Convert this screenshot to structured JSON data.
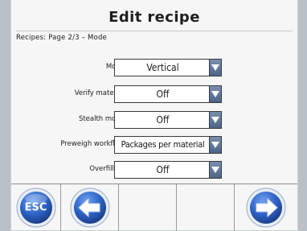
{
  "header": {
    "title": "Edit recipe",
    "breadcrumb": "Recipes: Page 2/3 – Mode"
  },
  "form": {
    "rows": [
      {
        "label": "Mode",
        "value": "Vertical"
      },
      {
        "label": "Verify material",
        "value": "Off"
      },
      {
        "label": "Stealth mode",
        "value": "Off"
      },
      {
        "label": "Preweigh workflow",
        "value": "Packages per material"
      },
      {
        "label": "Overfilling",
        "value": "Off"
      }
    ]
  },
  "toolbar": {
    "esc_label": "ESC",
    "buttons": [
      "esc-icon",
      "arrow-left-icon",
      "empty",
      "empty",
      "arrow-right-icon"
    ]
  },
  "colors": {
    "accent": "#2f63c4",
    "dropdown": "#5b6f93",
    "screen_bg": "#f6f6f6"
  }
}
